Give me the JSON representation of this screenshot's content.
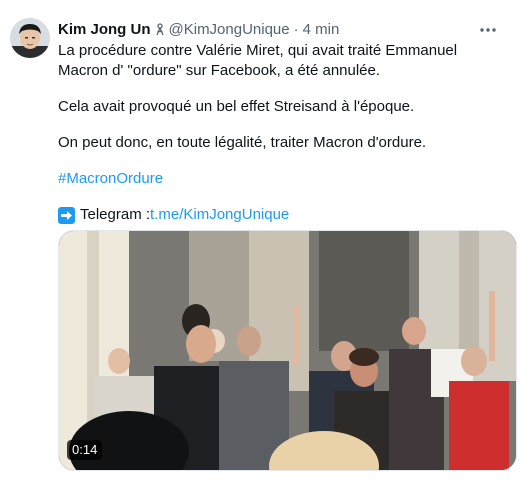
{
  "tweet": {
    "author_name": "Kim Jong Un",
    "author_handle": "@KimJongUnique",
    "separator": "·",
    "timestamp": "4 min",
    "paragraphs": [
      "La procédure contre Valérie Miret, qui avait traité Emmanuel Macron d' \"ordure\" sur Facebook, a été annulée.",
      "Cela avait provoqué un bel effet Streisand à l'époque.",
      "On peut donc, en toute légalité, traiter Macron d'ordure."
    ],
    "hashtag": "#MacronOrdure",
    "telegram_label": "Telegram : ",
    "telegram_link": "t.me/KimJongUnique",
    "video_duration": "0:14"
  },
  "icons": {
    "badge": "affiliate-badge-icon",
    "more": "more-options-icon",
    "arrow": "right-arrow-emoji-icon"
  },
  "colors": {
    "link": "#1d9bf0",
    "secondary_text": "#536471",
    "primary_text": "#0f1419"
  }
}
